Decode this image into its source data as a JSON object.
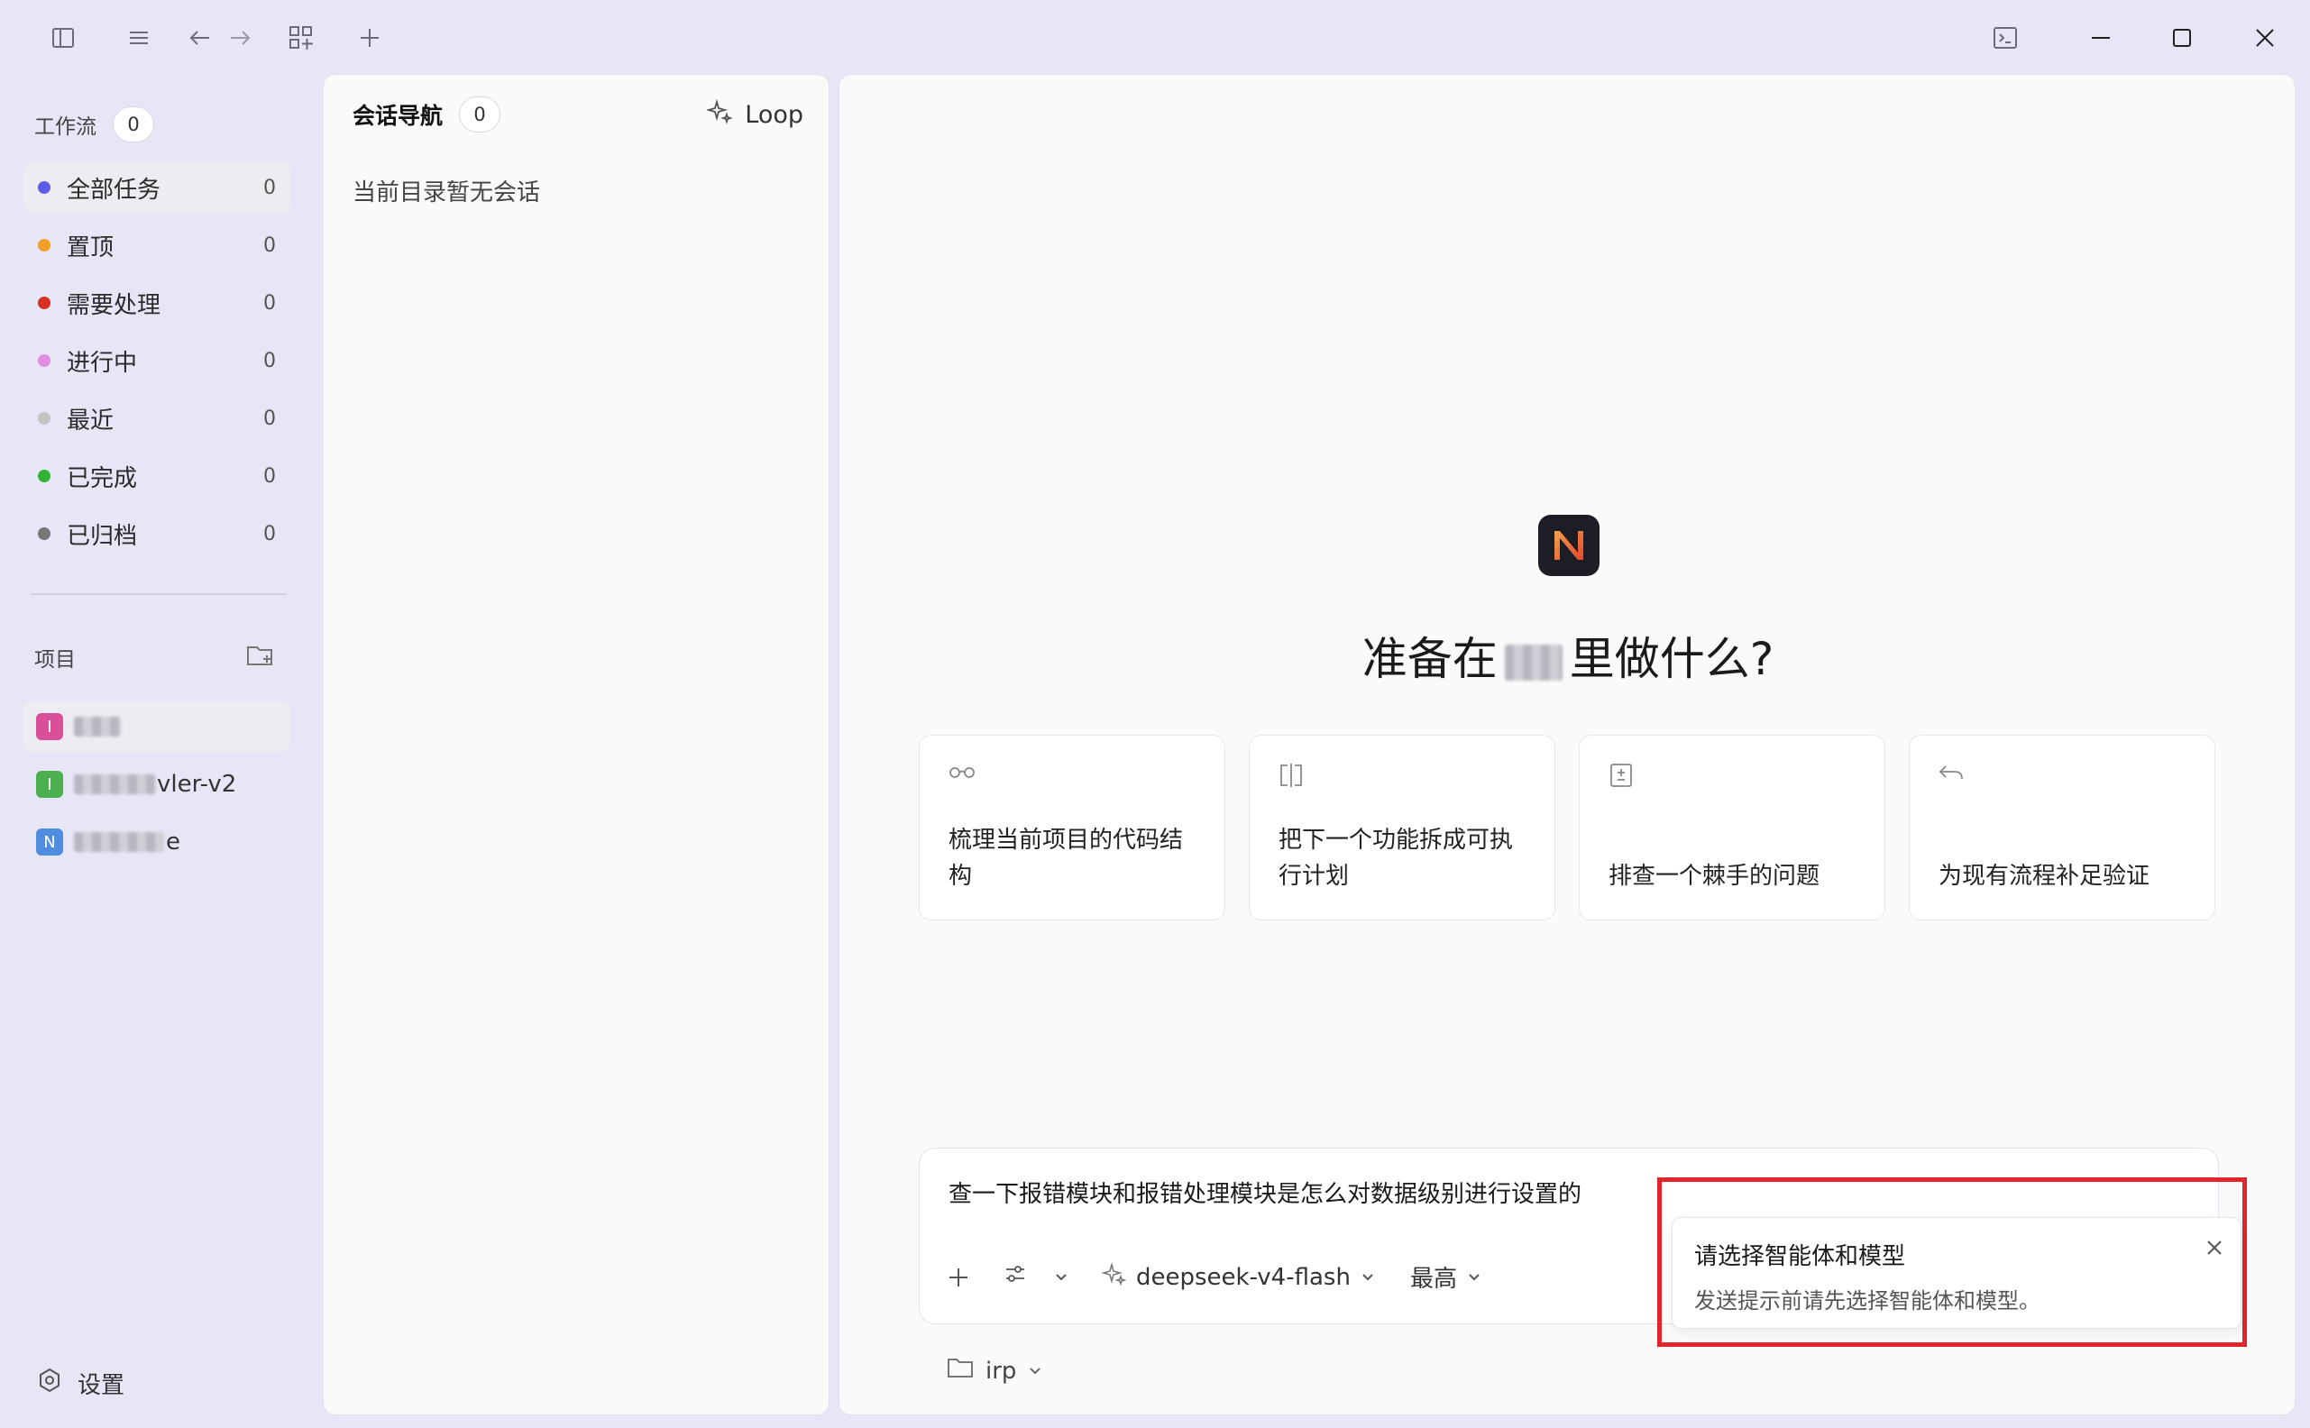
{
  "titlebar": {
    "icons": [
      "sidebar-toggle-icon",
      "menu-icon",
      "back-icon",
      "forward-icon",
      "grid-add-icon",
      "plus-icon",
      "terminal-icon",
      "minimize-icon",
      "maximize-icon",
      "close-icon"
    ]
  },
  "sidebar": {
    "workflow_title": "工作流",
    "workflow_count": "0",
    "items": [
      {
        "label": "全部任务",
        "count": "0",
        "color": "#5b5fe8"
      },
      {
        "label": "置顶",
        "count": "0",
        "color": "#f0a028"
      },
      {
        "label": "需要处理",
        "count": "0",
        "color": "#d93025"
      },
      {
        "label": "进行中",
        "count": "0",
        "color": "#e58ce6"
      },
      {
        "label": "最近",
        "count": "0",
        "color": "#c4c4c4"
      },
      {
        "label": "已完成",
        "count": "0",
        "color": "#34b233"
      },
      {
        "label": "已归档",
        "count": "0",
        "color": "#777777"
      }
    ],
    "projects_title": "项目",
    "projects": [
      {
        "badge": "I",
        "badge_color": "#d94f9a",
        "name_suffix": ""
      },
      {
        "badge": "I",
        "badge_color": "#4caf50",
        "name_suffix": "vler-v2"
      },
      {
        "badge": "N",
        "badge_color": "#4f8de0",
        "name_suffix": "e"
      }
    ],
    "settings_label": "设置"
  },
  "session_panel": {
    "title": "会话导航",
    "count": "0",
    "loop_label": "Loop",
    "empty_text": "当前目录暂无会话"
  },
  "main": {
    "logo_letter": "N",
    "hero_prefix": "准备在",
    "hero_suffix": "里做什么?",
    "cards": [
      {
        "icon": "glasses-icon",
        "text": "梳理当前项目的代码结构"
      },
      {
        "icon": "split-icon",
        "text": "把下一个功能拆成可执行计划"
      },
      {
        "icon": "diff-icon",
        "text": "排查一个棘手的问题"
      },
      {
        "icon": "undo-icon",
        "text": "为现有流程补足验证"
      }
    ],
    "composer": {
      "text": "查一下报错模块和报错处理模块是怎么对数据级别进行设置的",
      "model": "deepseek-v4-flash",
      "effort": "最高"
    },
    "folder": "irp"
  },
  "toast": {
    "title": "请选择智能体和模型",
    "message": "发送提示前请先选择智能体和模型。"
  }
}
